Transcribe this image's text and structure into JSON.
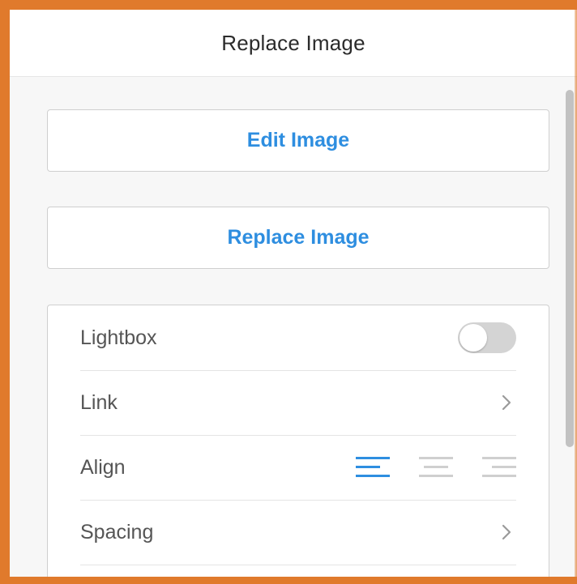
{
  "panel": {
    "title": "Replace Image"
  },
  "buttons": {
    "edit_label": "Edit Image",
    "replace_label": "Replace Image"
  },
  "settings": {
    "lightbox_label": "Lightbox",
    "lightbox_on": false,
    "link_label": "Link",
    "align_label": "Align",
    "align_selected": "left",
    "spacing_label": "Spacing"
  },
  "icons": {
    "link_chevron": "chevron-right-icon",
    "spacing_chevron": "chevron-right-icon",
    "align_left": "align-left-icon",
    "align_center": "align-center-icon",
    "align_right": "align-right-icon"
  },
  "colors": {
    "accent": "#2e8ee0",
    "frame": "#e07a2c",
    "toggle_off": "#d4d4d4",
    "text": "#555555"
  }
}
